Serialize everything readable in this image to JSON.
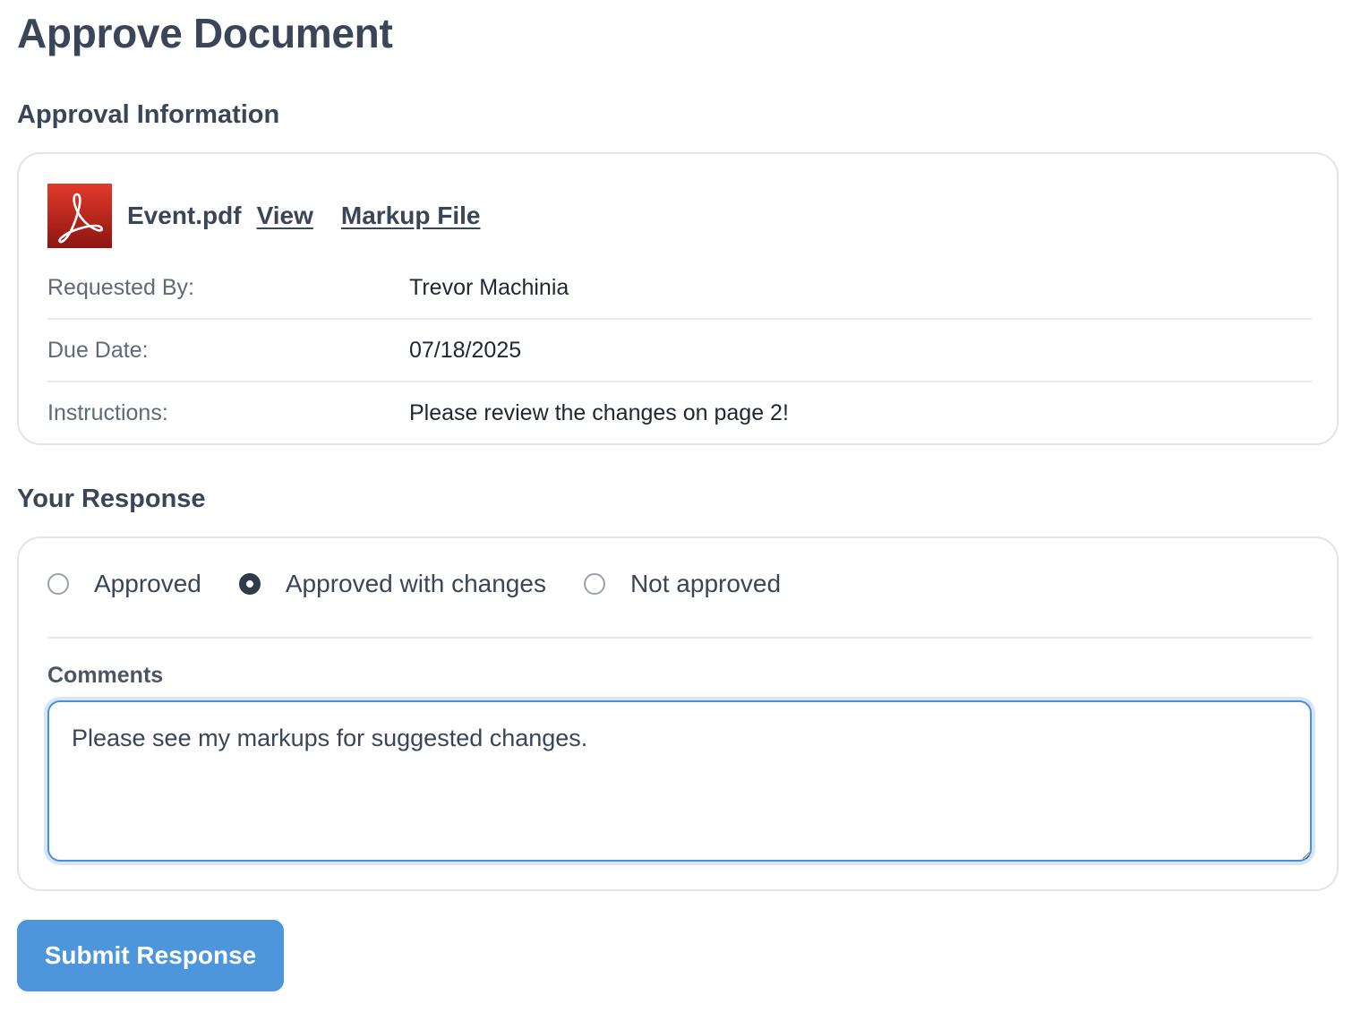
{
  "page": {
    "title": "Approve Document"
  },
  "approval_info": {
    "section_title": "Approval Information",
    "file": {
      "icon": "pdf-file-icon",
      "name": "Event.pdf",
      "view_link": "View",
      "markup_link": "Markup File"
    },
    "details": [
      {
        "label": "Requested By:",
        "value": "Trevor Machinia"
      },
      {
        "label": "Due Date:",
        "value": "07/18/2025"
      },
      {
        "label": "Instructions:",
        "value": "Please review the changes on page 2!"
      }
    ]
  },
  "response": {
    "section_title": "Your Response",
    "options": [
      {
        "label": "Approved",
        "selected": false
      },
      {
        "label": "Approved with changes",
        "selected": true
      },
      {
        "label": "Not approved",
        "selected": false
      }
    ],
    "comments_label": "Comments",
    "comments_value": "Please see my markups for suggested changes."
  },
  "actions": {
    "submit_label": "Submit Response"
  },
  "colors": {
    "primary_button": "#4d96dc",
    "text": "#3a4658",
    "focus_border": "#4a90d9",
    "pdf_red": "#c4221b"
  }
}
